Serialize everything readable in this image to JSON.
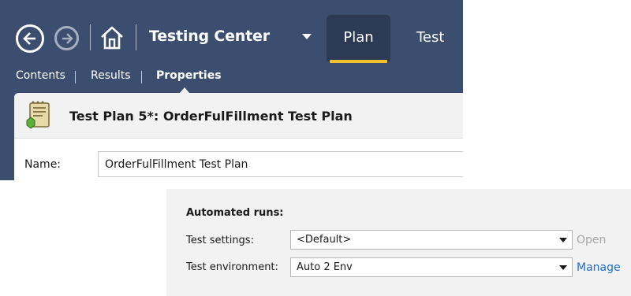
{
  "header": {
    "hub_title": "Testing Center",
    "tabs": [
      {
        "label": "Plan",
        "selected": true
      },
      {
        "label": "Test",
        "selected": false
      }
    ],
    "icons": [
      "back-icon",
      "forward-icon",
      "home-icon",
      "dropdown-icon"
    ]
  },
  "subnav": {
    "items": [
      {
        "label": "Contents"
      },
      {
        "label": "Results"
      },
      {
        "label": "Properties",
        "selected": true
      }
    ]
  },
  "plan": {
    "title": "Test Plan 5*: OrderFulFillment Test Plan",
    "name_label": "Name:",
    "name_value": "OrderFulFillment Test Plan"
  },
  "automated_runs": {
    "title": "Automated runs:",
    "test_settings_label": "Test settings:",
    "test_settings_value": "<Default>",
    "open_link": "Open",
    "test_environment_label": "Test environment:",
    "test_environment_value": "Auto 2 Env",
    "manage_link": "Manage"
  },
  "colors": {
    "header_bg": "#3b4e6f",
    "selected_tab_bg": "#2c3a55",
    "tab_underline": "#f2c12e",
    "link": "#1e6fc8",
    "disabled_link": "#a6a6a6"
  }
}
